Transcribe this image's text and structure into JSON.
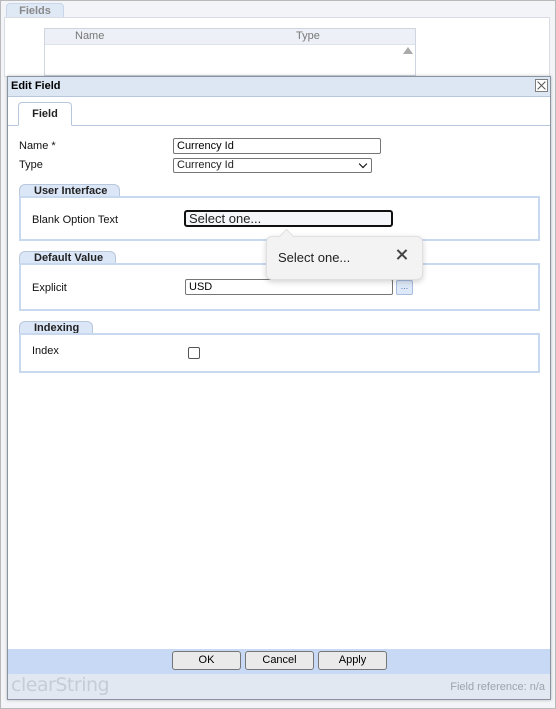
{
  "background": {
    "tab_label": "Fields",
    "grid_headers": [
      "Name",
      "Type"
    ]
  },
  "dialog": {
    "title": "Edit Field",
    "tab_label": "Field",
    "name_label": "Name *",
    "name_value": "Currency Id",
    "type_label": "Type",
    "type_value": "Currency Id",
    "groups": {
      "user_interface": {
        "title": "User Interface",
        "blank_option_label": "Blank Option Text",
        "blank_option_value": "Select one..."
      },
      "default_value": {
        "title": "Default Value",
        "explicit_label": "Explicit",
        "explicit_value": "USD",
        "ellipsis": "..."
      },
      "indexing": {
        "title": "Indexing",
        "index_label": "Index",
        "index_checked": false
      }
    },
    "popup_text": "Select one...",
    "buttons": {
      "ok": "OK",
      "cancel": "Cancel",
      "apply": "Apply"
    },
    "brand": "clearString",
    "field_reference": "Field reference: n/a"
  }
}
